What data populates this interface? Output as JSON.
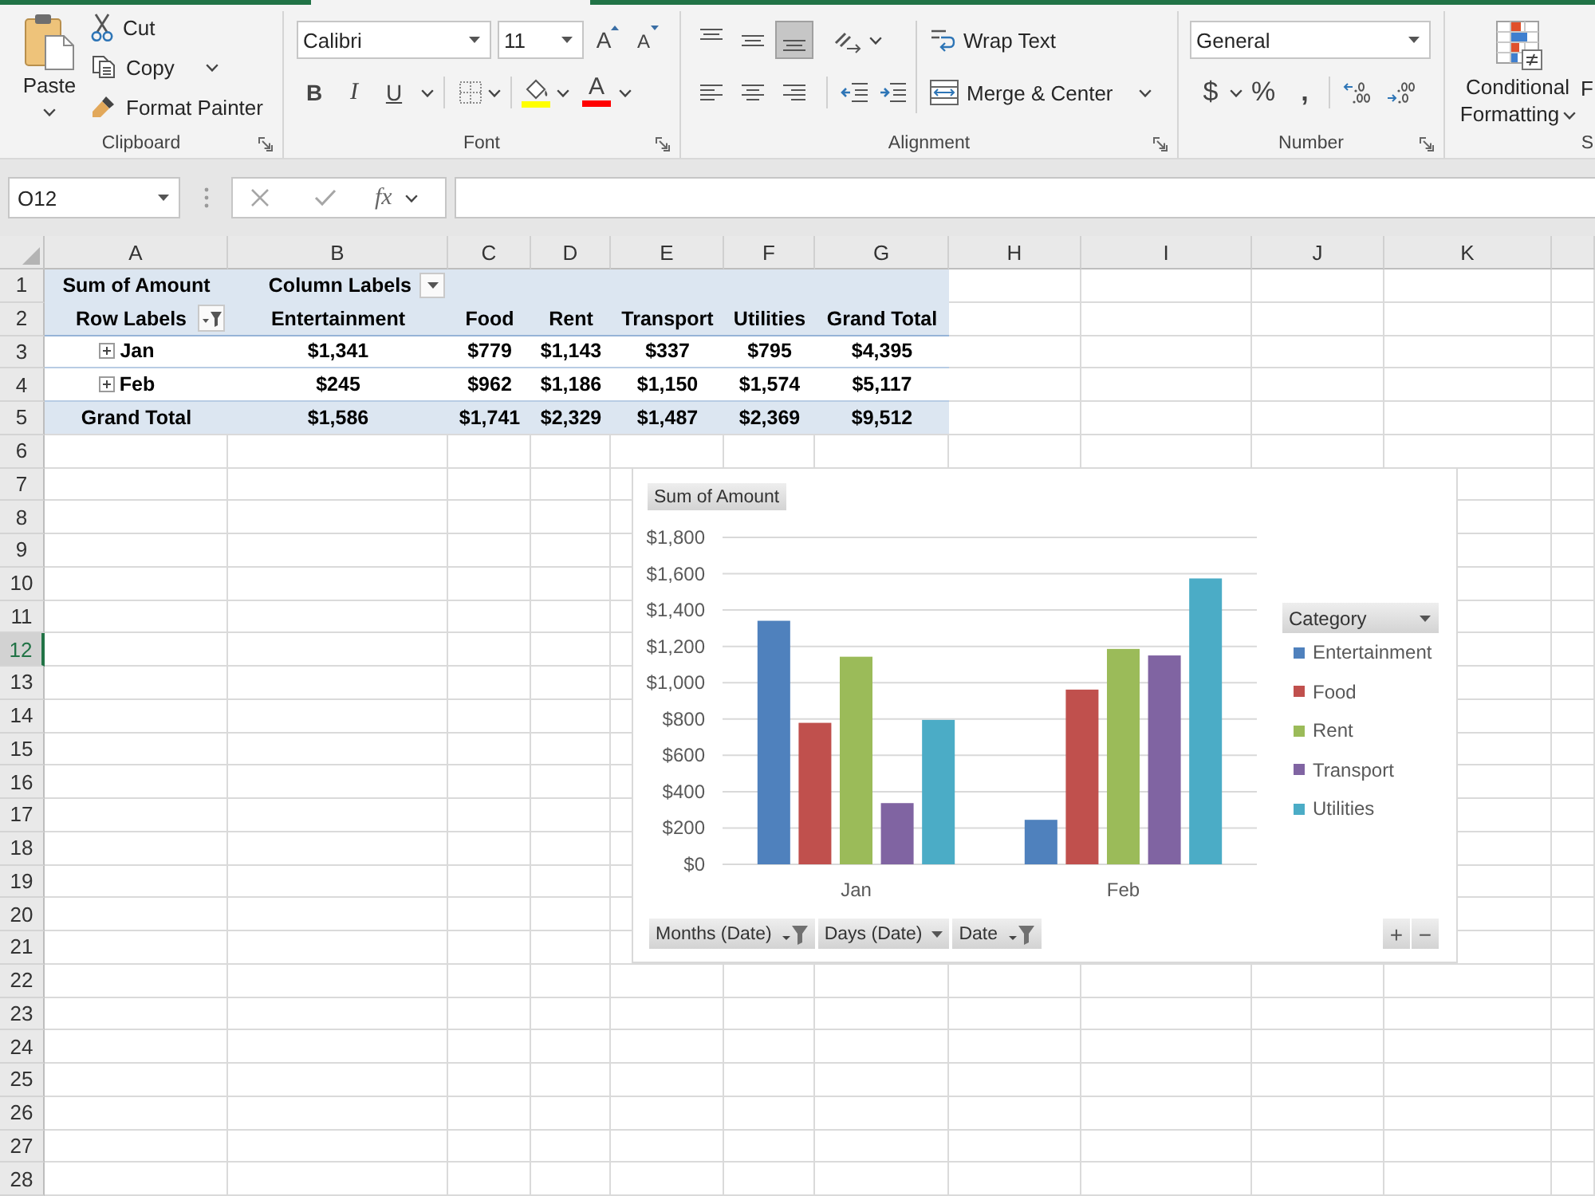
{
  "ribbon": {
    "clipboard": {
      "label": "Clipboard",
      "paste": "Paste",
      "actions": [
        "Cut",
        "Copy",
        "Format Painter"
      ]
    },
    "font": {
      "label": "Font",
      "name": "Calibri",
      "size": "11",
      "size_buttons": [
        "A",
        "A"
      ],
      "style_buttons": [
        "B",
        "I",
        "U"
      ],
      "color_button": "A"
    },
    "alignment": {
      "label": "Alignment",
      "vertical_align": [
        {
          "kind": "top",
          "selected": false
        },
        {
          "kind": "middle",
          "selected": false
        },
        {
          "kind": "bottom",
          "selected": true
        }
      ],
      "horizontal_align": [
        {
          "kind": "left",
          "selected": false
        },
        {
          "kind": "center",
          "selected": false
        },
        {
          "kind": "right",
          "selected": false
        }
      ],
      "wrap_text": "Wrap Text",
      "merge": "Merge & Center"
    },
    "number": {
      "label": "Number",
      "format": "General",
      "symbol_buttons": [
        "$",
        "%",
        ","
      ]
    },
    "styles": {
      "label": "S",
      "buttons": [
        "Conditional Formatting",
        "F"
      ]
    }
  },
  "formula_bar": {
    "name_box": "O12",
    "insert_function": "fx"
  },
  "sheet": {
    "columns": [
      "A",
      "B",
      "C",
      "D",
      "E",
      "F",
      "G",
      "H",
      "I",
      "J",
      "K"
    ],
    "rows": [
      {
        "label": "1",
        "selected": false
      },
      {
        "label": "2",
        "selected": false
      },
      {
        "label": "3",
        "selected": false
      },
      {
        "label": "4",
        "selected": false
      },
      {
        "label": "5",
        "selected": false
      },
      {
        "label": "6",
        "selected": false
      },
      {
        "label": "7",
        "selected": false
      },
      {
        "label": "8",
        "selected": false
      },
      {
        "label": "9",
        "selected": false
      },
      {
        "label": "10",
        "selected": false
      },
      {
        "label": "11",
        "selected": false
      },
      {
        "label": "12",
        "selected": true
      },
      {
        "label": "13",
        "selected": false
      },
      {
        "label": "14",
        "selected": false
      },
      {
        "label": "15",
        "selected": false
      },
      {
        "label": "16",
        "selected": false
      },
      {
        "label": "17",
        "selected": false
      },
      {
        "label": "18",
        "selected": false
      },
      {
        "label": "19",
        "selected": false
      },
      {
        "label": "20",
        "selected": false
      },
      {
        "label": "21",
        "selected": false
      },
      {
        "label": "22",
        "selected": false
      },
      {
        "label": "23",
        "selected": false
      },
      {
        "label": "24",
        "selected": false
      },
      {
        "label": "25",
        "selected": false
      },
      {
        "label": "26",
        "selected": false
      },
      {
        "label": "27",
        "selected": false
      },
      {
        "label": "28",
        "selected": false
      }
    ]
  },
  "pivot_table": {
    "value_field": "Sum of Amount",
    "column_labels": "Column Labels",
    "row_labels": "Row Labels",
    "columns": [
      "Entertainment",
      "Food",
      "Rent",
      "Transport",
      "Utilities",
      "Grand Total"
    ],
    "rows": [
      {
        "label": "Jan",
        "expanded": false,
        "values": [
          "$1,341",
          "$779",
          "$1,143",
          "$337",
          "$795",
          "$4,395"
        ]
      },
      {
        "label": "Feb",
        "expanded": false,
        "values": [
          "$245",
          "$962",
          "$1,186",
          "$1,150",
          "$1,574",
          "$5,117"
        ]
      }
    ],
    "grand_total": {
      "label": "Grand Total",
      "values": [
        "$1,586",
        "$1,741",
        "$2,329",
        "$1,487",
        "$2,369",
        "$9,512"
      ]
    }
  },
  "pivot_chart": {
    "value_button": "Sum of Amount",
    "legend_button": "Category",
    "axis_buttons": [
      {
        "label": "Months (Date)",
        "kind": "filter"
      },
      {
        "label": "Days (Date)",
        "kind": "dropdown"
      },
      {
        "label": "Date",
        "kind": "filter"
      }
    ],
    "zoom_buttons": [
      "+",
      "−"
    ],
    "chart_data": {
      "type": "bar",
      "orientation": "vertical",
      "grid": true,
      "categories": [
        "Jan",
        "Feb"
      ],
      "series": [
        {
          "name": "Entertainment",
          "color": "#4f81bd",
          "values": [
            1341,
            245
          ]
        },
        {
          "name": "Food",
          "color": "#c0504d",
          "values": [
            779,
            962
          ]
        },
        {
          "name": "Rent",
          "color": "#9bbb59",
          "values": [
            1143,
            1186
          ]
        },
        {
          "name": "Transport",
          "color": "#8064a2",
          "values": [
            337,
            1150
          ]
        },
        {
          "name": "Utilities",
          "color": "#4bacc6",
          "values": [
            795,
            1574
          ]
        }
      ],
      "ylim": [
        0,
        1800
      ],
      "yticks": [
        {
          "value": 0,
          "label": "$0"
        },
        {
          "value": 200,
          "label": "$200"
        },
        {
          "value": 400,
          "label": "$400"
        },
        {
          "value": 600,
          "label": "$600"
        },
        {
          "value": 800,
          "label": "$800"
        },
        {
          "value": 1000,
          "label": "$1,000"
        },
        {
          "value": 1200,
          "label": "$1,200"
        },
        {
          "value": 1400,
          "label": "$1,400"
        },
        {
          "value": 1600,
          "label": "$1,600"
        },
        {
          "value": 1800,
          "label": "$1,800"
        }
      ]
    }
  }
}
